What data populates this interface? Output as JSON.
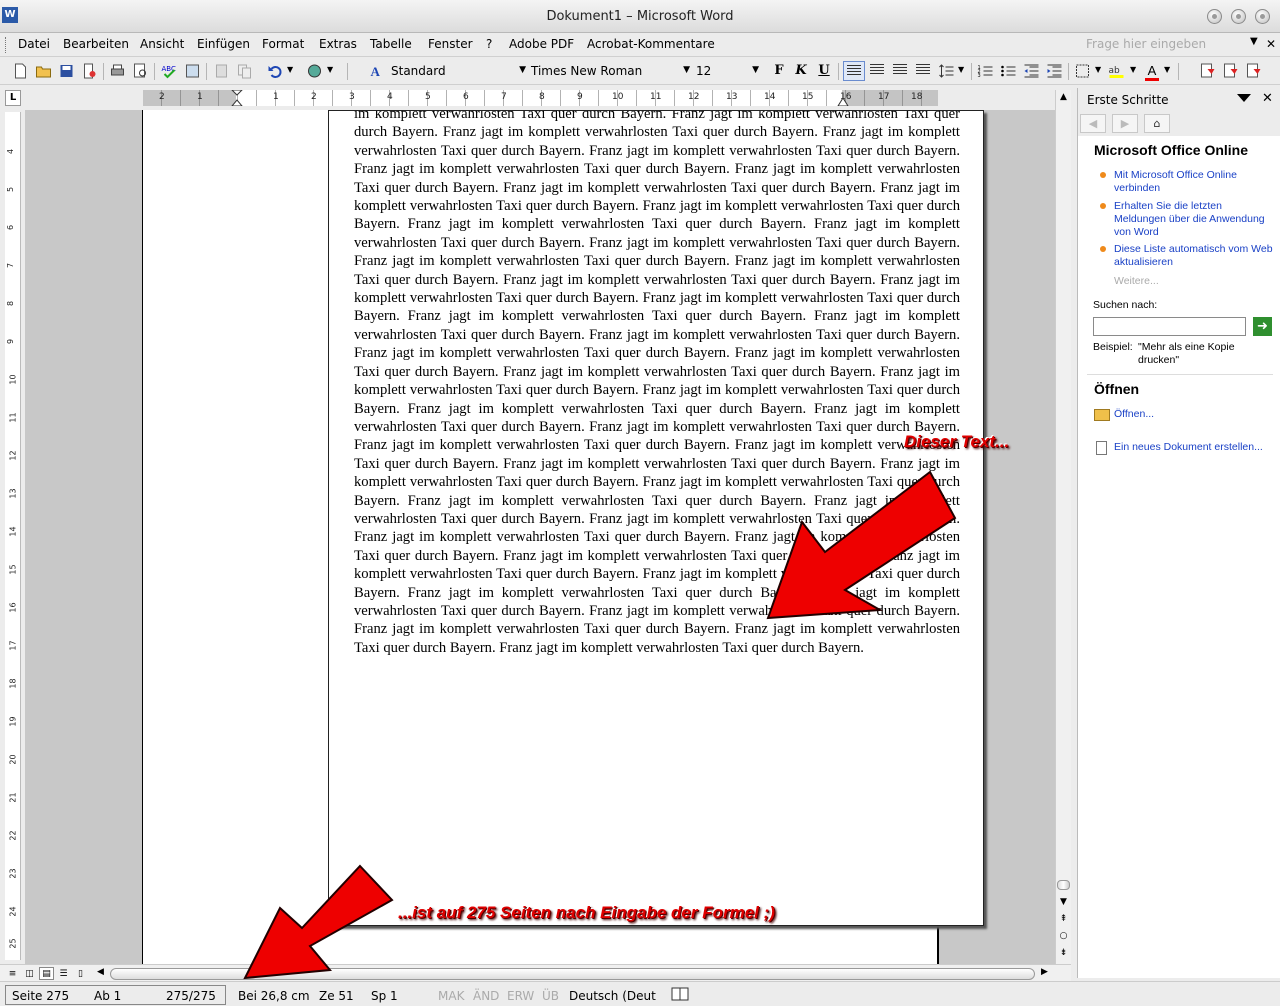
{
  "window": {
    "title": "Dokument1 – Microsoft Word"
  },
  "menu": {
    "items": [
      "Datei",
      "Bearbeiten",
      "Ansicht",
      "Einfügen",
      "Format",
      "Extras",
      "Tabelle",
      "Fenster",
      "?",
      "Adobe PDF",
      "Acrobat-Kommentare"
    ],
    "help_placeholder": "Frage hier eingeben"
  },
  "toolbar": {
    "style": "Standard",
    "font": "Times New Roman",
    "size": "12",
    "bold": "F",
    "italic": "K",
    "underline": "U",
    "font_color": "A"
  },
  "ruler": {
    "h_numbers": [
      "2",
      "1",
      "1",
      "2",
      "3",
      "4",
      "5",
      "6",
      "7",
      "8",
      "9",
      "10",
      "11",
      "12",
      "13",
      "14",
      "15",
      "16",
      "17",
      "18"
    ],
    "v_numbers": [
      "4",
      "5",
      "6",
      "7",
      "8",
      "9",
      "10",
      "11",
      "12",
      "13",
      "14",
      "15",
      "16",
      "17",
      "18",
      "19",
      "20",
      "21",
      "22",
      "23",
      "24",
      "25"
    ]
  },
  "document": {
    "text": "im komplett verwahrlosten Taxi quer durch Bayern. Franz jagt im komplett verwahrlosten Taxi quer durch Bayern. Franz jagt im komplett verwahrlosten Taxi quer durch Bayern. Franz jagt im komplett verwahrlosten Taxi quer durch Bayern. Franz jagt im komplett verwahrlosten Taxi quer durch Bayern. Franz jagt im komplett verwahrlosten Taxi quer durch Bayern. Franz jagt im komplett verwahrlosten Taxi quer durch Bayern. Franz jagt im komplett verwahrlosten Taxi quer durch Bayern. Franz jagt im komplett verwahrlosten Taxi quer durch Bayern. Franz jagt im komplett verwahrlosten Taxi quer durch Bayern. Franz jagt im komplett verwahrlosten Taxi quer durch Bayern. Franz jagt im komplett verwahrlosten Taxi quer durch Bayern. Franz jagt im komplett verwahrlosten Taxi quer durch Bayern. Franz jagt im komplett verwahrlosten Taxi quer durch Bayern. Franz jagt im komplett verwahrlosten Taxi quer durch Bayern. Franz jagt im komplett verwahrlosten Taxi quer durch Bayern. Franz jagt im komplett verwahrlosten Taxi quer durch Bayern. Franz jagt im komplett verwahrlosten Taxi quer durch Bayern. Franz jagt im komplett verwahrlosten Taxi quer durch Bayern. Franz jagt im komplett verwahrlosten Taxi quer durch Bayern. Franz jagt im komplett verwahrlosten Taxi quer durch Bayern. Franz jagt im komplett verwahrlosten Taxi quer durch Bayern. Franz jagt im komplett verwahrlosten Taxi quer durch Bayern. Franz jagt im komplett verwahrlosten Taxi quer durch Bayern. Franz jagt im komplett verwahrlosten Taxi quer durch Bayern. Franz jagt im komplett verwahrlosten Taxi quer durch Bayern. Franz jagt im komplett verwahrlosten Taxi quer durch Bayern. Franz jagt im komplett verwahrlosten Taxi quer durch Bayern. Franz jagt im komplett verwahrlosten Taxi quer durch Bayern. Franz jagt im komplett verwahrlosten Taxi quer durch Bayern. Franz jagt im komplett verwahrlosten Taxi quer durch Bayern. Franz jagt im komplett verwahrlosten Taxi quer durch Bayern. Franz jagt im komplett verwahrlosten Taxi quer durch Bayern. Franz jagt im komplett verwahrlosten Taxi quer durch Bayern. Franz jagt im komplett verwahrlosten Taxi quer durch Bayern. Franz jagt im komplett verwahrlosten Taxi quer durch Bayern. Franz jagt im komplett verwahrlosten Taxi quer durch Bayern. Franz jagt im komplett verwahrlosten Taxi quer durch Bayern. Franz jagt im komplett verwahrlosten Taxi quer durch Bayern. Franz jagt im komplett verwahrlosten Taxi quer durch Bayern. Franz jagt im komplett verwahrlosten Taxi quer durch Bayern. Franz jagt im komplett verwahrlosten Taxi quer durch Bayern. Franz jagt im komplett verwahrlosten Taxi quer durch Bayern. Franz jagt im komplett verwahrlosten Taxi quer durch Bayern. Franz jagt im komplett verwahrlosten Taxi quer durch Bayern. Franz jagt im komplett verwahrlosten Taxi quer durch Bayern. Franz jagt im komplett verwahrlosten Taxi quer durch Bayern. Franz jagt im komplett verwahrlosten Taxi quer durch Bayern."
  },
  "taskpane": {
    "title": "Erste Schritte",
    "section_online": "Microsoft Office Online",
    "links": [
      "Mit Microsoft Office Online verbinden",
      "Erhalten Sie die letzten Meldungen über die Anwendung von Word",
      "Diese Liste automatisch vom Web aktualisieren"
    ],
    "more": "Weitere...",
    "search_label": "Suchen nach:",
    "example_label": "Beispiel:",
    "example_text": "\"Mehr als eine Kopie drucken\"",
    "section_open": "Öffnen",
    "open_link": "Öffnen...",
    "new_doc_link": "Ein neues Dokument erstellen..."
  },
  "status": {
    "page": "Seite 275",
    "section": "Ab 1",
    "pages": "275/275",
    "at": "Bei 26,8 cm",
    "line": "Ze 51",
    "col": "Sp 1",
    "mak": "MAK",
    "and": "ÄND",
    "erw": "ERW",
    "ub": "ÜB",
    "language": "Deutsch (Deut"
  },
  "annotations": {
    "top": "Dieser Text...",
    "bottom": "...ist auf 275 Seiten nach Eingabe der Formel ;)"
  },
  "colors": {
    "annotation": "#e00000",
    "link": "#1a41c6",
    "bullet": "#ef8a1b"
  }
}
